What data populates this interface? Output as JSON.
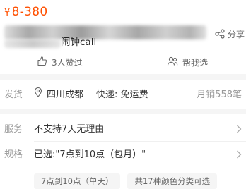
{
  "price": {
    "symbol": "¥",
    "range": "8-380"
  },
  "title": {
    "visible_suffix": "闹钟call"
  },
  "share": {
    "label": "分享"
  },
  "likes": {
    "label": "3人赞过"
  },
  "help_select": {
    "label": "帮我选"
  },
  "shipping": {
    "label": "发货",
    "location": "四川成都",
    "express": "快递: 免运费",
    "monthly_sales": "月销558笔"
  },
  "service": {
    "label": "服务",
    "value": "不支持7天无理由"
  },
  "spec": {
    "label": "规格",
    "value": "已选:\"7点到10点（包月）\"",
    "chips": [
      "7点到10点（单天）",
      "共17种颜色分类可选"
    ]
  },
  "colors": {
    "accent": "#ff5000",
    "muted": "#999999",
    "divider": "#f5f5f5"
  }
}
